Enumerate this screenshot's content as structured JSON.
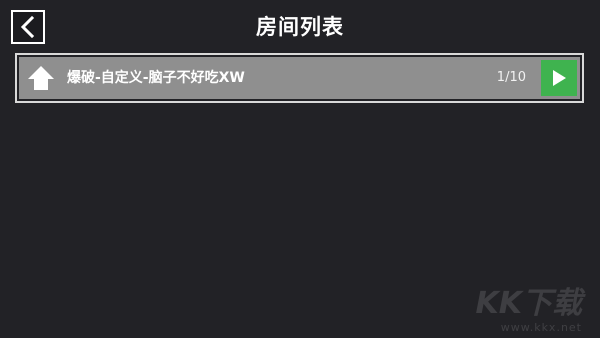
{
  "header": {
    "title": "房间列表",
    "back_icon": "chevron-left-icon"
  },
  "rooms": [
    {
      "name": "爆破-自定义-脑子不好吃XW",
      "players": "1/10",
      "icon": "home-icon",
      "action_icon": "play-icon",
      "action_color": "#3fb34f"
    }
  ],
  "watermark": {
    "logo": "KK下载",
    "url": "www.kkx.net"
  },
  "colors": {
    "background": "#222226",
    "row": "#8f8f8f",
    "accent": "#3fb34f"
  }
}
